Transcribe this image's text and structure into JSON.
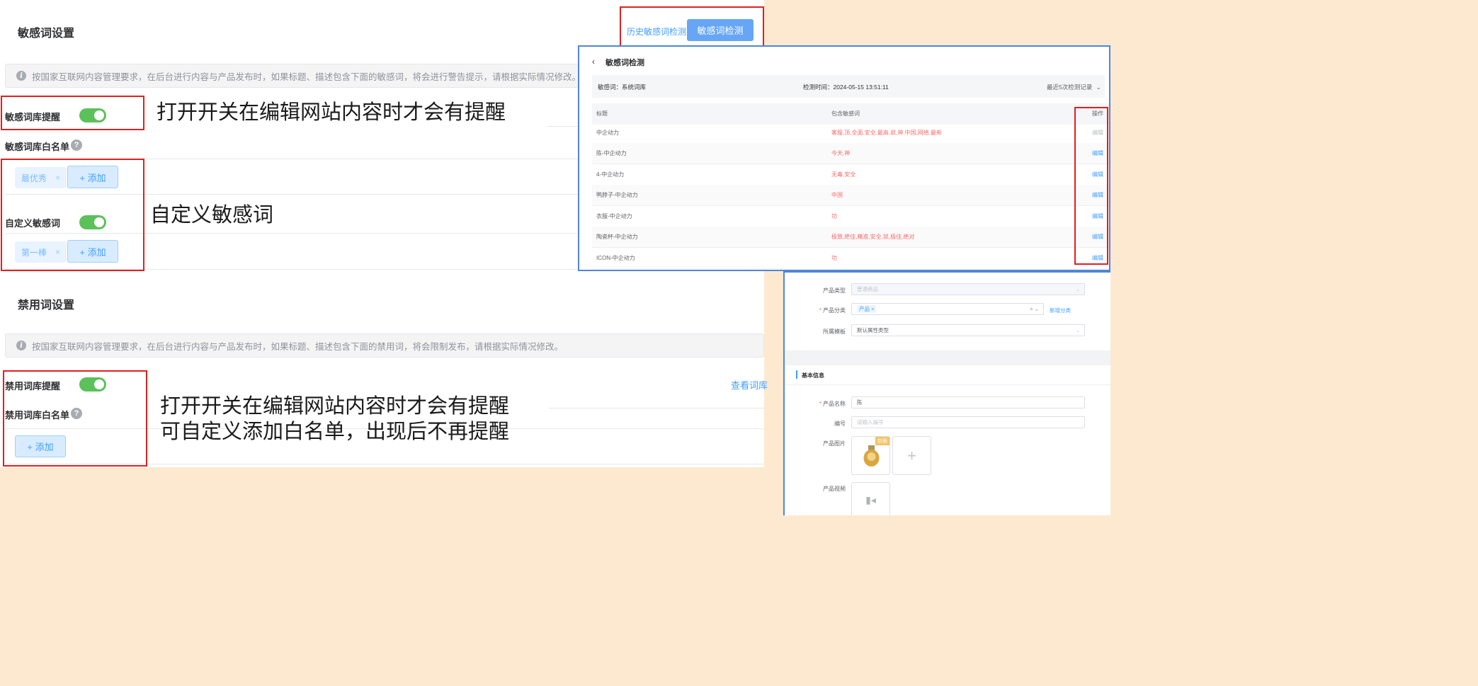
{
  "sensitive": {
    "title": "敏感词设置",
    "notice": "按国家互联网内容管理要求，在后台进行内容与产品发布时，如果标题、描述包含下面的敏感词，将会进行警告提示，请根据实际情况修改。",
    "reminder_label": "敏感词库提醒",
    "whitelist_label": "敏感词库白名单",
    "whitelist_tags": [
      "最优秀"
    ],
    "custom_label": "自定义敏感词",
    "custom_tags": [
      "第一棒"
    ],
    "add_label": "+ 添加",
    "history_link": "历史敏感词检测",
    "detect_button": "敏感词检测"
  },
  "banned": {
    "title": "禁用词设置",
    "notice": "按国家互联网内容管理要求，在后台进行内容与产品发布时，如果标题、描述包含下面的禁用词，将会限制发布，请根据实际情况修改。",
    "reminder_label": "禁用词库提醒",
    "whitelist_label": "禁用词库白名单",
    "add_label": "+ 添加",
    "view_link": "查看词库"
  },
  "annotations": {
    "a1": "打开开关在编辑网站内容时才会有提醒",
    "a2": "自定义敏感词",
    "a3_line1": "打开开关在编辑网站内容时才会有提醒",
    "a3_line2": "可自定义添加白名单，出现后不再提醒"
  },
  "detect": {
    "back_icon": "chevron-left-icon",
    "title": "敏感词检测",
    "lexicon": "敏感词：系统词库",
    "time": "检测时间：2024-05-15 13:51:11",
    "history": "最近5次检测记录",
    "columns": [
      "标题",
      "包含敏感词",
      "操作"
    ],
    "rows": [
      {
        "title": "中企动力",
        "words": "客服,顶,全面,安全,最高,就,神,中国,网络,最新",
        "action": "编辑"
      },
      {
        "title": "陈-中企动力",
        "words": "今天,神",
        "action": "编辑"
      },
      {
        "title": "4-中企动力",
        "words": "无毒,安全",
        "action": "编辑"
      },
      {
        "title": "鸭脖子-中企动力",
        "words": "中国",
        "action": "编辑"
      },
      {
        "title": "衣服-中企动力",
        "words": "功",
        "action": "编辑"
      },
      {
        "title": "陶瓷杯-中企动力",
        "words": "极致,绝佳,精准,安全,就,极佳,绝对",
        "action": "编辑"
      },
      {
        "title": "ICON-中企动力",
        "words": "功",
        "action": "编辑"
      }
    ]
  },
  "product": {
    "type_label": "产品类型",
    "type_value": "普通商品",
    "category_label": "产品分类",
    "category_tag": "产品",
    "add_category": "新增分类",
    "template_label": "所属模板",
    "template_value": "默认属性类型",
    "basic_info": "基本信息",
    "name_label": "产品名称",
    "name_value": "陈",
    "code_label": "编号",
    "code_placeholder": "请输入编号",
    "image_label": "产品图片",
    "cover_badge": "封面",
    "video_label": "产品视频"
  }
}
